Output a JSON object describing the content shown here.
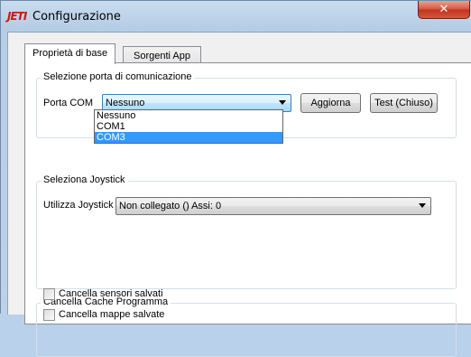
{
  "window": {
    "logo_text": "JETI",
    "title": "Configurazione",
    "close_glyph": "✕"
  },
  "tabs": [
    {
      "label": "Proprietà di base",
      "active": true
    },
    {
      "label": "Sorgenti App",
      "active": false
    }
  ],
  "com_group": {
    "legend": "Selezione porta di comunicazione",
    "port_label": "Porta COM",
    "selected_value": "Nessuno",
    "refresh_button": "Aggiorna",
    "test_button": "Test (Chiuso)",
    "options": [
      "Nessuno",
      "COM1",
      "COM3"
    ],
    "highlighted_option": "COM3"
  },
  "joystick_group": {
    "legend": "Seleziona Joystick",
    "use_label": "Utilizza Joystick",
    "selected_value": "Non collegato () Assi: 0"
  },
  "cache_group": {
    "legend": "Cancella Cache Programma",
    "checkboxes": [
      {
        "label": "Cancella sensori salvati",
        "checked": false
      },
      {
        "label": "Cancella mappe salvate",
        "checked": false
      }
    ]
  },
  "icons": {
    "close": "close-icon",
    "dropdown": "chevron-down-icon"
  }
}
